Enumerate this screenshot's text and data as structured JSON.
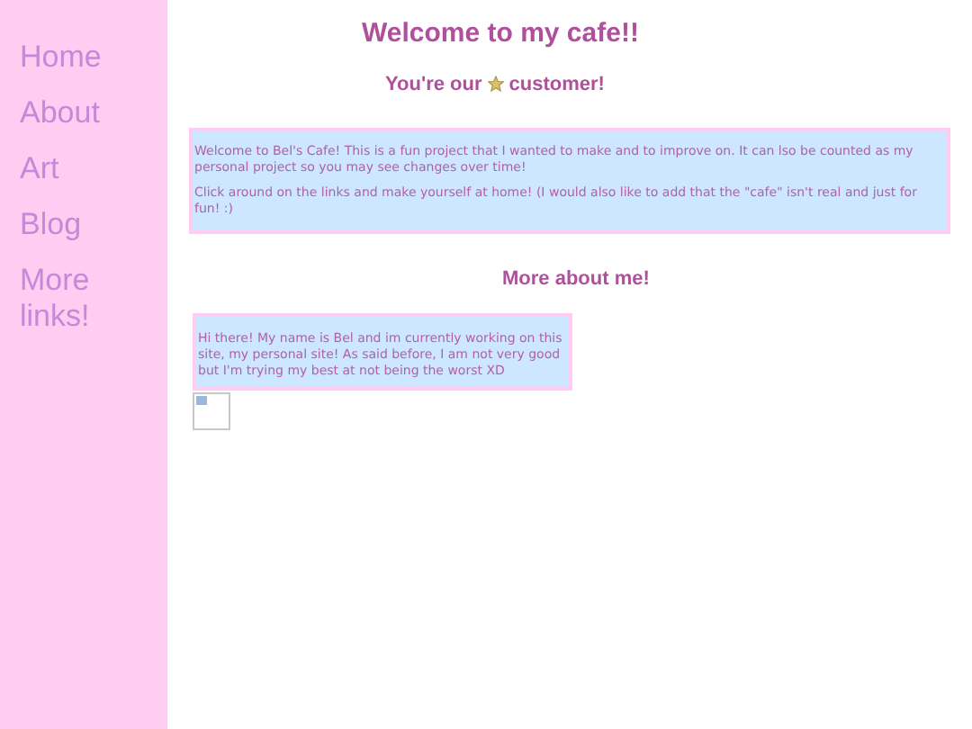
{
  "sidebar": {
    "links": [
      "Home",
      "About",
      "Art",
      "Blog",
      "More links!"
    ]
  },
  "header": {
    "title": "Welcome to my cafe!!",
    "subtitle_before": "You're our",
    "subtitle_after": "customer!"
  },
  "intro": {
    "paragraphs": [
      "Welcome to Bel's Cafe! This is a fun project that I wanted to make and to improve on. It can lso be counted as my personal project so you may see changes over time!",
      "Click around on the links and make yourself at home! (I would also like to add that the \"cafe\" isn't real and just for fun! :)"
    ]
  },
  "about": {
    "heading": "More about me!",
    "text": "Hi there! My name is Bel and im currently working on this site, my personal site! As said before, I am not very good but I'm trying my best at not being the worst XD"
  }
}
